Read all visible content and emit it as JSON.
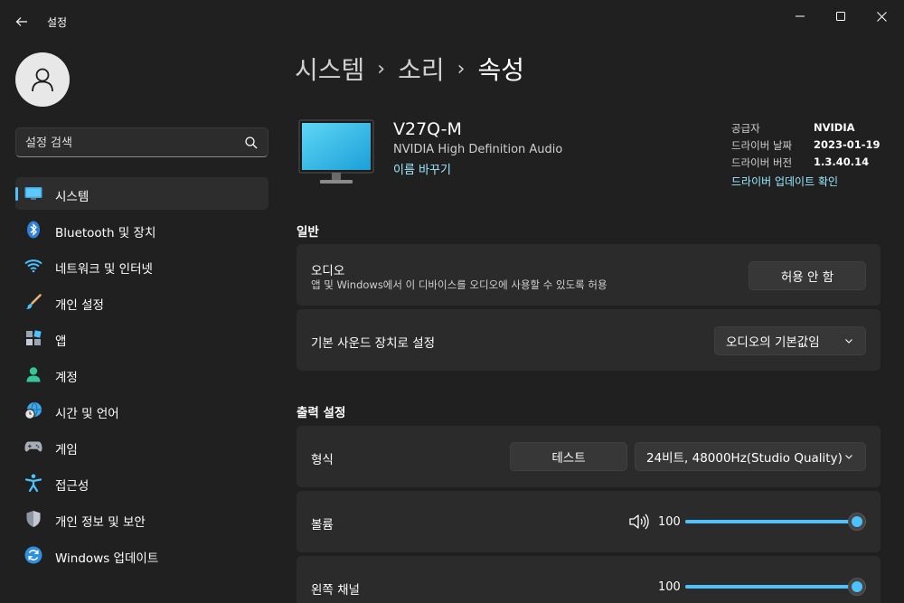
{
  "window": {
    "title": "설정"
  },
  "sidebar": {
    "search_placeholder": "설정 검색",
    "items": [
      {
        "label": "시스템",
        "icon": "monitor-icon",
        "active": true
      },
      {
        "label": "Bluetooth 및 장치",
        "icon": "bluetooth-icon"
      },
      {
        "label": "네트워크 및 인터넷",
        "icon": "wifi-icon"
      },
      {
        "label": "개인 설정",
        "icon": "paintbrush-icon"
      },
      {
        "label": "앱",
        "icon": "apps-icon"
      },
      {
        "label": "계정",
        "icon": "person-icon"
      },
      {
        "label": "시간 및 언어",
        "icon": "globe-clock-icon"
      },
      {
        "label": "게임",
        "icon": "gamepad-icon"
      },
      {
        "label": "접근성",
        "icon": "accessibility-icon"
      },
      {
        "label": "개인 정보 및 보안",
        "icon": "shield-icon"
      },
      {
        "label": "Windows 업데이트",
        "icon": "update-icon"
      }
    ]
  },
  "breadcrumb": {
    "parts": [
      "시스템",
      "소리"
    ],
    "separator": "›",
    "current": "속성"
  },
  "device": {
    "name": "V27Q-M",
    "driver_name": "NVIDIA High Definition Audio",
    "rename_label": "이름 바꾸기",
    "info": [
      {
        "label": "공급자",
        "value": "NVIDIA"
      },
      {
        "label": "드라이버 날짜",
        "value": "2023-01-19"
      },
      {
        "label": "드라이버 버전",
        "value": "1.3.40.14"
      }
    ],
    "driver_update_label": "드라이버 업데이트 확인"
  },
  "general": {
    "title": "일반",
    "audio": {
      "label": "오디오",
      "description": "앱 및 Windows에서 이 디바이스를 오디오에 사용할 수 있도록 허용",
      "button_label": "허용 안 함"
    },
    "default_device": {
      "label": "기본 사운드 장치로 설정",
      "selected": "오디오의 기본값임"
    }
  },
  "output": {
    "title": "출력 설정",
    "format": {
      "label": "형식",
      "test_label": "테스트",
      "selected": "24비트, 48000Hz(Studio Quality)"
    },
    "volume": {
      "label": "볼륨",
      "value": 100
    },
    "left_channel": {
      "label": "왼쪽 채널",
      "value": 100
    }
  },
  "colors": {
    "background": "#202020",
    "card": "#2b2b2b",
    "accent": "#4cc2ff",
    "link": "#99ebff"
  }
}
